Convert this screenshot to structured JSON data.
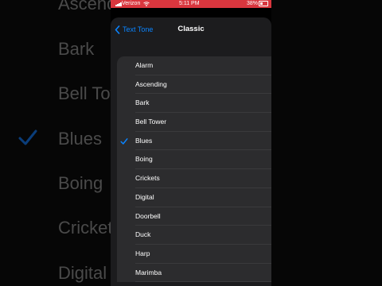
{
  "status_bar": {
    "carrier": "Verizon",
    "time": "5:11 PM",
    "battery": "38%"
  },
  "nav": {
    "back_label": "Text Tone",
    "title": "Classic"
  },
  "tones": [
    {
      "label": "Alarm"
    },
    {
      "label": "Ascending"
    },
    {
      "label": "Bark"
    },
    {
      "label": "Bell Tower"
    },
    {
      "label": "Blues"
    },
    {
      "label": "Boing"
    },
    {
      "label": "Crickets"
    },
    {
      "label": "Digital"
    },
    {
      "label": "Doorbell"
    },
    {
      "label": "Duck"
    },
    {
      "label": "Harp"
    },
    {
      "label": "Marimba"
    }
  ],
  "selected_tone": "Blues",
  "background_items": [
    "Ascending",
    "Bark",
    "Bell Tower",
    "Blues",
    "Boing",
    "Crickets",
    "Digital"
  ],
  "colors": {
    "accent": "#0a84ff",
    "status_bar": "#d9363e",
    "sheet": "#1c1c1e",
    "cell": "#2c2c2e"
  }
}
